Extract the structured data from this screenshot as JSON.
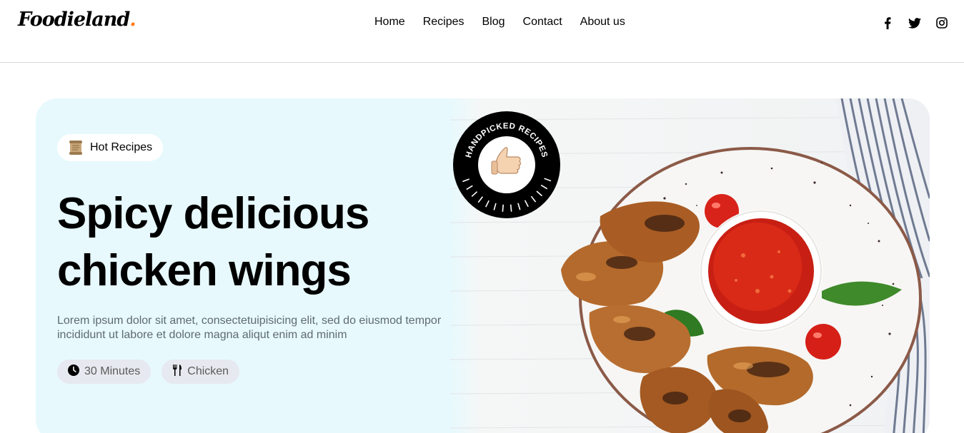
{
  "header": {
    "logo_main": "Foodieland",
    "logo_dot": ".",
    "nav": [
      "Home",
      "Recipes",
      "Blog",
      "Contact",
      "About us"
    ],
    "social_icons": [
      "facebook-icon",
      "twitter-icon",
      "instagram-icon"
    ]
  },
  "hero": {
    "tag_label": "Hot Recipes",
    "tag_icon": "scroll-icon",
    "title": "Spicy delicious chicken wings",
    "description": "Lorem ipsum dolor sit amet, consectetuipisicing elit, sed do eiusmod tempor incididunt ut labore et dolore magna aliqut enim ad minim",
    "chips": [
      {
        "icon": "clock-icon",
        "label": "30 Minutes"
      },
      {
        "icon": "fork-knife-icon",
        "label": "Chicken"
      }
    ],
    "badge_text": "HANDPICKED RECIPES",
    "badge_icon": "thumbs-up-icon"
  },
  "colors": {
    "hero_bg": "#e7f9fd",
    "logo_accent": "#ff7a1a",
    "chip_bg": "#e6e9ef"
  }
}
